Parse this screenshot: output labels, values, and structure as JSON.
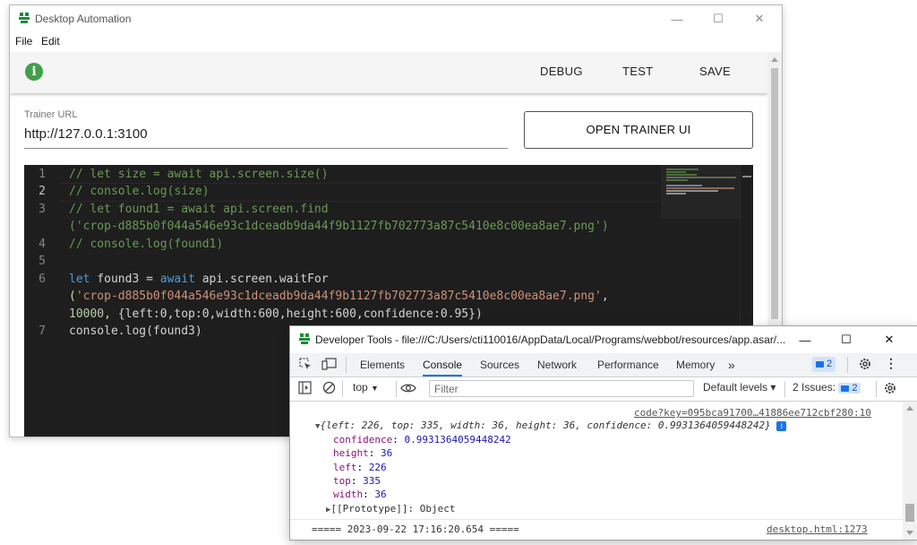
{
  "main_window": {
    "title": "Desktop Automation",
    "menu": [
      "File",
      "Edit"
    ],
    "toolbar": {
      "info_icon": "i",
      "debug": "DEBUG",
      "test": "TEST",
      "save": "SAVE"
    },
    "trainer": {
      "label": "Trainer URL",
      "value": "http://127.0.0.1:3100",
      "open_button": "OPEN TRAINER UI"
    },
    "editor": {
      "line_numbers": [
        "1",
        "2",
        "3",
        "4",
        "5",
        "6",
        "7"
      ],
      "comment1": "// let size = await api.screen.size()",
      "comment2": "// console.log(size)",
      "comment3a": "// let found1 = await api.screen.find",
      "comment3b": "('crop-d885b0f044a546e93c1dceadb9da44f9b1127fb702773a87c5410e8c00ea8ae7.png')",
      "comment4": "// console.log(found1)",
      "l6_let": "let",
      "l6_var": " found3 = ",
      "l6_await": "await",
      "l6_call": " api.screen.waitFor",
      "l6_paren": "(",
      "l6_str": "'crop-d885b0f044a546e93c1dceadb9da44f9b1127fb702773a87c5410e8c00ea8ae7.png'",
      "l6_comma": ",",
      "l6_num": "10000",
      "l6_opts": ", {left:0,top:0,width:600,height:600,confidence:0.95})",
      "l7": "console.log(found3)"
    }
  },
  "devtools": {
    "title": "Developer Tools - file:///C:/Users/cti110016/AppData/Local/Programs/webbot/resources/app.asar/...",
    "tabs": [
      "Elements",
      "Console",
      "Sources",
      "Network",
      "Performance",
      "Memory"
    ],
    "more_tabs": "»",
    "messages_badge": "2",
    "context": "top",
    "filter_placeholder": "Filter",
    "default_levels": "Default levels ▾",
    "issues": "2 Issues:",
    "issues_count": "2",
    "console": {
      "source1": "code?key=095bca91700…41886ee712cbf280:10",
      "summary": "{left: 226, top: 335, width: 36, height: 36, confidence: 0.9931364059448242}",
      "props": [
        {
          "key": "confidence",
          "value": "0.9931364059448242"
        },
        {
          "key": "height",
          "value": "36"
        },
        {
          "key": "left",
          "value": "226"
        },
        {
          "key": "top",
          "value": "335"
        },
        {
          "key": "width",
          "value": "36"
        }
      ],
      "prototype": "[[Prototype]]: Object",
      "timestamp_line": "===== 2023-09-22 17:16:20.654 =====",
      "source2": "desktop.html:1273"
    }
  }
}
